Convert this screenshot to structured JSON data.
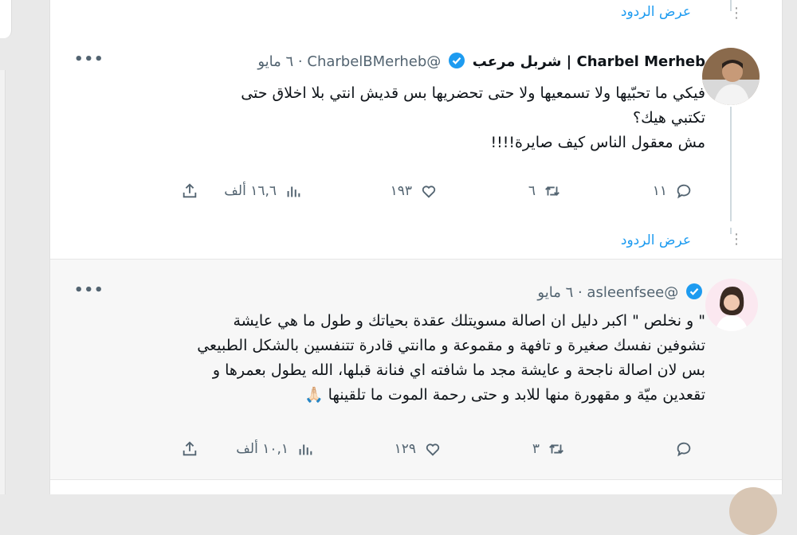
{
  "show_replies_label": "عرض الردود",
  "tweets": [
    {
      "display_name": "Charbel Merheb | شربل مرعب",
      "handle": "@CharbelBMerheb",
      "time": "٦ مايو",
      "lines": [
        "فيكي ما تحبّيها ولا تسمعيها ولا حتى تحضريها بس قديش انتي بلا اخلاق حتى",
        "تكتبي هيك؟",
        "مش معقول الناس كيف صايرة!!!!"
      ],
      "replies": "١١",
      "retweets": "٦",
      "likes": "١٩٣",
      "views": "١٦,٦ ألف"
    },
    {
      "display_name": "",
      "handle": "@asleenfsee",
      "time": "٦ مايو",
      "lines": [
        "\" و نخلص \" اكبر دليل ان اصالة مسويتلك عقدة بحياتك و طول ما هي عايشة",
        "تشوفين نفسك صغيرة و تافهة و مقموعة و ماانتي قادرة تتنفسين بالشكل الطبيعي",
        "بس لان اصالة ناجحة و عايشة مجد ما شافته اي فنانة قبلها، الله يطول بعمرها و",
        "تقعدين ميّة و مقهورة منها للابد و حتى رحمة الموت ما تلقينها 🙏🏻"
      ],
      "replies": "",
      "retweets": "٣",
      "likes": "١٢٩",
      "views": "١٠,١ ألف"
    }
  ],
  "icons": {
    "reply": "reply-icon",
    "retweet": "retweet-icon",
    "like": "heart-icon",
    "views": "views-icon",
    "share": "share-icon",
    "verified": "verified-badge-icon",
    "more": "more-options-icon"
  },
  "colors": {
    "link": "#1d9bf0",
    "verified": "#1d9bf0",
    "muted": "#536471"
  }
}
